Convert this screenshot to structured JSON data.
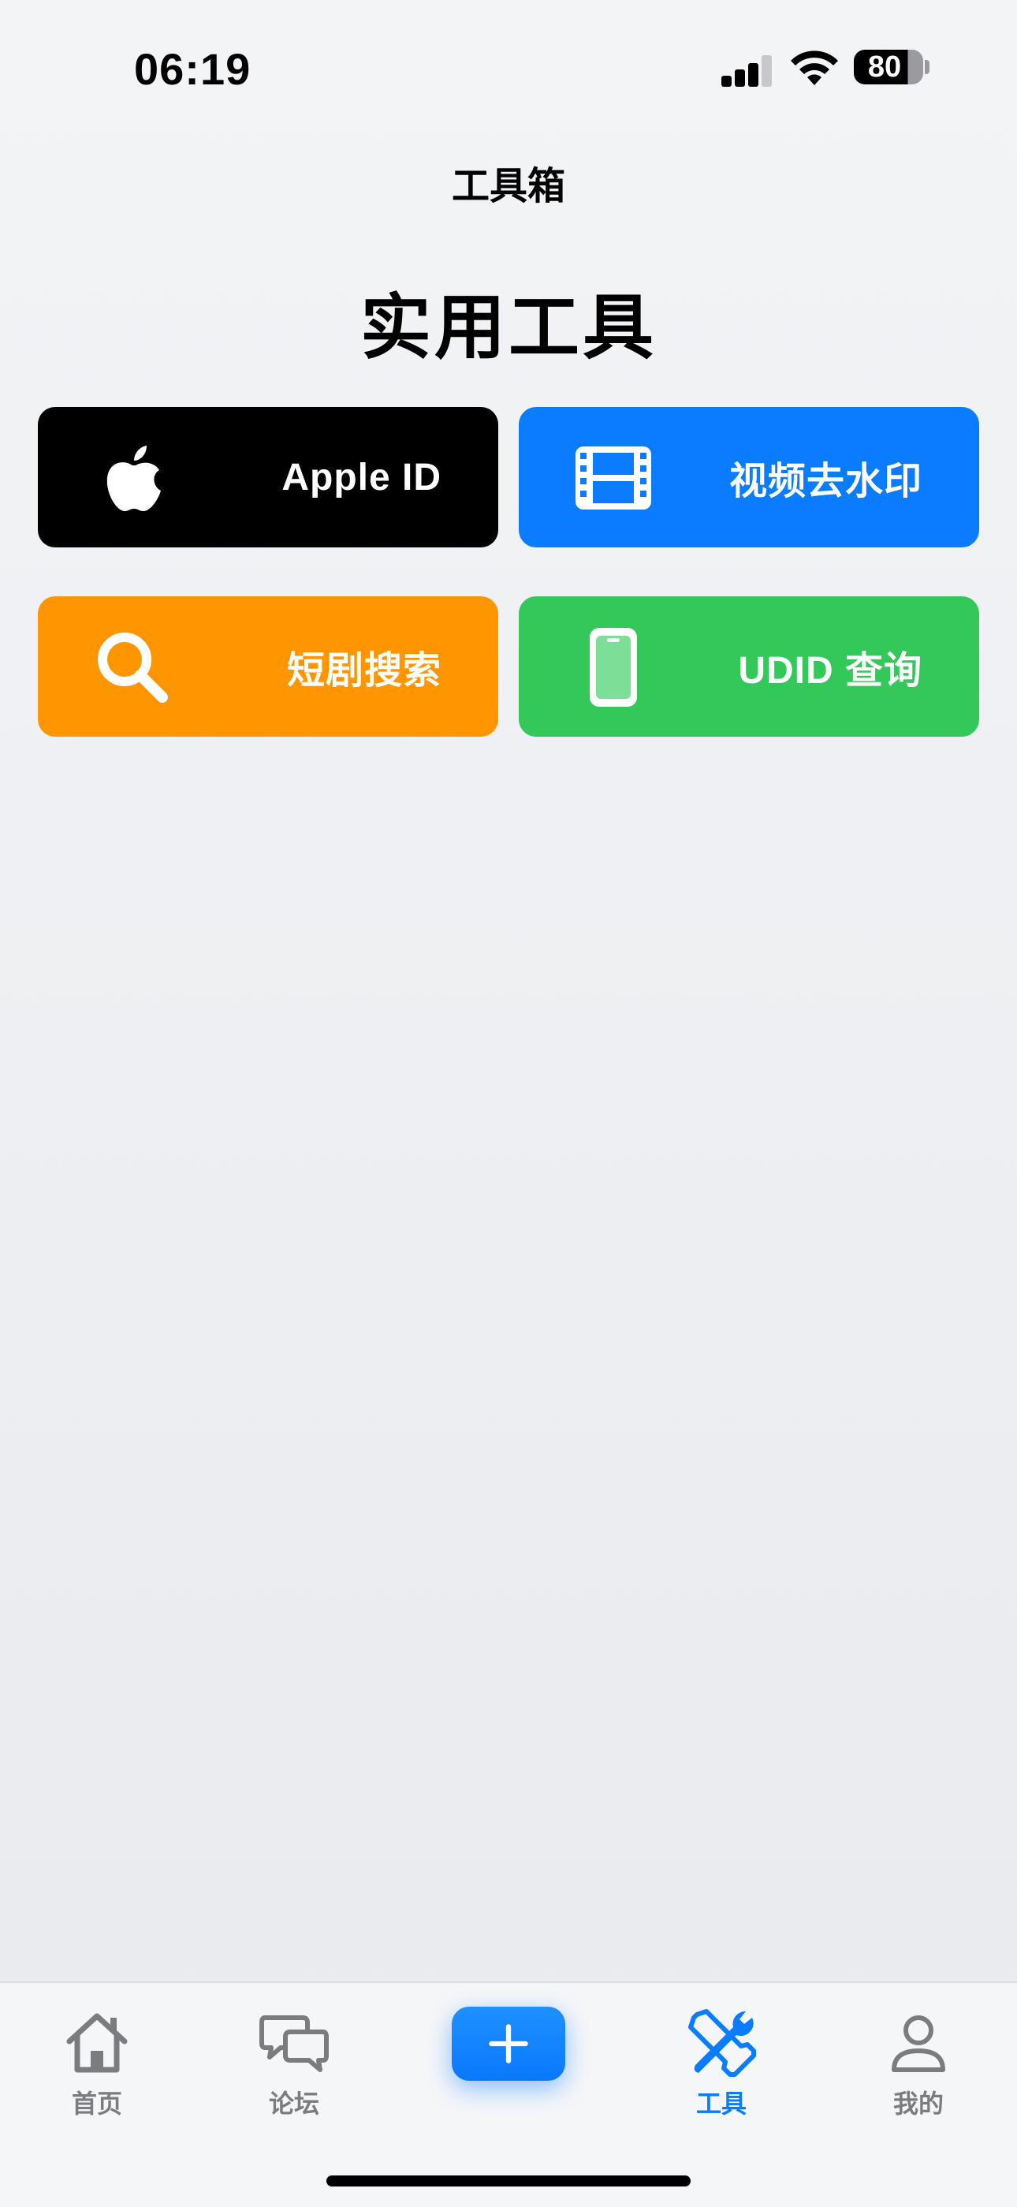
{
  "status_bar": {
    "time": "06:19",
    "battery_level": "80"
  },
  "nav": {
    "title": "工具箱"
  },
  "section": {
    "title": "实用工具"
  },
  "tools": [
    {
      "label": "Apple ID",
      "color": "#000000",
      "icon": "apple-logo-icon"
    },
    {
      "label": "视频去水印",
      "color": "#0A7CFF",
      "icon": "film-icon"
    },
    {
      "label": "短剧搜索",
      "color": "#FF9500",
      "icon": "search-icon"
    },
    {
      "label": "UDID 查询",
      "color": "#34C759",
      "icon": "phone-icon"
    }
  ],
  "tab_bar": {
    "items": [
      {
        "label": "首页",
        "icon": "home-icon",
        "active": false
      },
      {
        "label": "论坛",
        "icon": "chat-bubbles-icon",
        "active": false
      },
      {
        "label": "",
        "icon": "plus-icon",
        "active": false
      },
      {
        "label": "工具",
        "icon": "tools-icon",
        "active": true
      },
      {
        "label": "我的",
        "icon": "person-icon",
        "active": false
      }
    ],
    "active_color": "#0A7CFF"
  }
}
